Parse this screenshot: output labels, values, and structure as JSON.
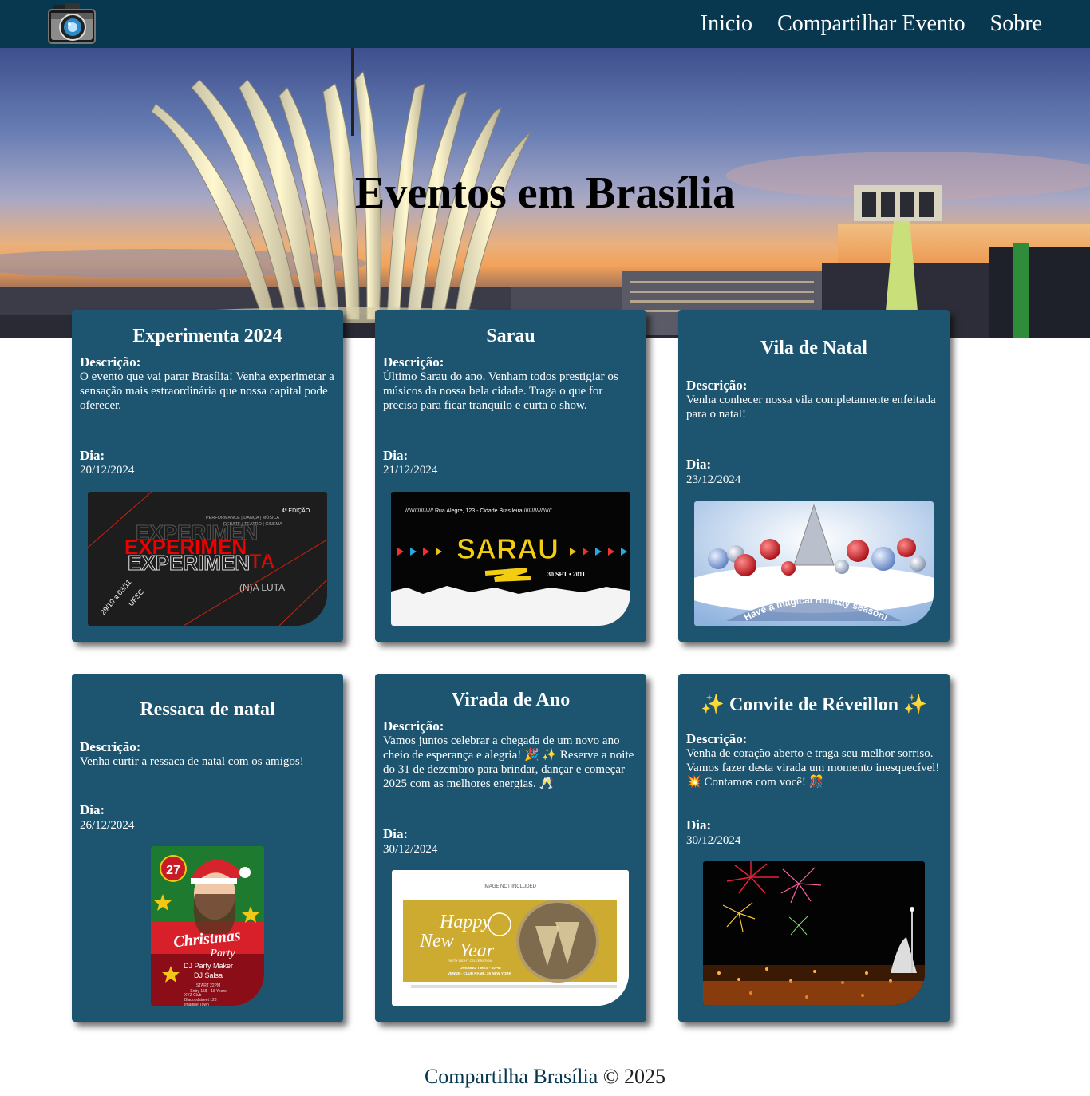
{
  "nav": {
    "logo_icon": "camera-icon",
    "links": [
      "Inicio",
      "Compartilhar Evento",
      "Sobre"
    ]
  },
  "hero": {
    "title": "Eventos em Brasília"
  },
  "labels": {
    "description": "Descrição:",
    "day": "Dia:"
  },
  "events": [
    {
      "title": "Experimenta 2024",
      "description": "O evento que vai parar Brasília! Venha experimetar a sensação mais estraordinária que nossa capital pode oferecer.",
      "date": "20/12/2024",
      "poster": {
        "edition": "4ª EDIÇÃO",
        "lines": [
          "PERFORMANCE | DANÇA | MÚSICA",
          "DEBATE | TEATRO | CINEMA"
        ],
        "word1": "EXPERIMEN",
        "word2": "TA",
        "subtitle": "(N)A LUTA",
        "dates": "29/10 a 03/11",
        "place": "UFSC"
      }
    },
    {
      "title": "Sarau",
      "description": "Último Sarau do ano. Venham todos prestigiar os músicos da nossa bela cidade. Traga o que for preciso para ficar tranquilo e curta o show.",
      "date": "21/12/2024",
      "poster": {
        "header": "//////////////////  Rua Alegre, 123 - Cidade Brasileira //////////////////",
        "word": "SARAU",
        "date": "30 SET • 2011"
      }
    },
    {
      "title": "Vila de Natal",
      "description": "Venha conhecer nossa vila completamente enfeitada para o natal!",
      "date": "23/12/2024",
      "poster": {
        "caption": "Have a magical Holiday season!"
      }
    },
    {
      "title": "Ressaca de natal",
      "description": "Venha curtir a ressaca de natal com os amigos!",
      "date": "26/12/2024",
      "poster": {
        "day": "27",
        "word1": "Christmas",
        "word2": "Party",
        "dj1": "DJ Party Maker",
        "dj2": "DJ Salsa",
        "start": "START 22PM",
        "entry": "Entry 15$ - 18 Years",
        "club": "XYZ Club",
        "street": "Bladobdstreet 123",
        "town": "Imagine Town"
      }
    },
    {
      "title": "Virada de Ano",
      "description": "Vamos juntos celebrar a chegada de um novo ano cheio de esperança e alegria! 🎉 ✨ Reserve a noite do 31 de dezembro para brindar, dançar e começar 2025 com as melhores energias. 🥂",
      "date": "30/12/2024",
      "poster": {
        "note": "IMAGE NOT INCLUDED",
        "word1": "Happy",
        "word2": "New",
        "word3": "Year",
        "sub": "PARTY NIGHT CELEBRATION",
        "times": "OPENING TIMES - 10PM",
        "venue": "VENUE - CLUB NAME, 25 NEW YORK"
      }
    },
    {
      "title": "✨ Convite de Réveillon ✨",
      "description": "Venha de coração aberto e traga seu melhor sorriso. Vamos fazer desta virada um momento inesquecível! 💥 Contamos com você! 🎊",
      "date": "30/12/2024"
    }
  ],
  "footer": {
    "brand": "Compartilha Brasília",
    "copy": "© 2025"
  }
}
